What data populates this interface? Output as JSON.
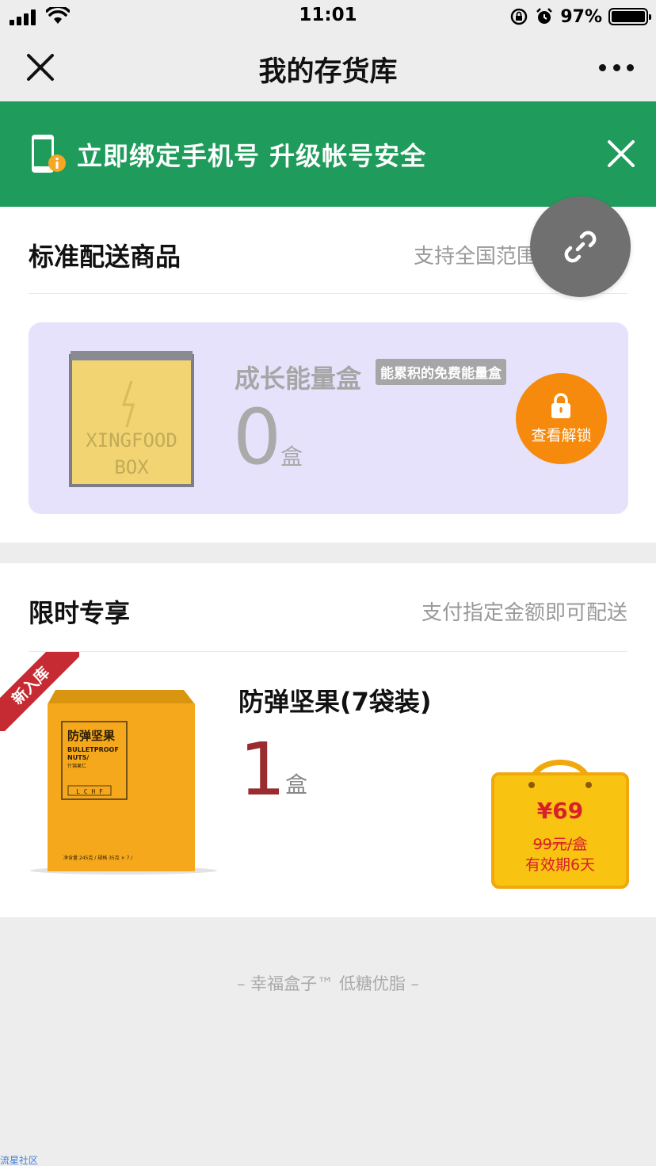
{
  "status_bar": {
    "time": "11:01",
    "battery": "97%"
  },
  "nav": {
    "title": "我的存货库"
  },
  "banner": {
    "text": "立即绑定手机号  升级帐号安全"
  },
  "standard": {
    "title": "标准配送商品",
    "subtitle": "支持全国范围",
    "card": {
      "box_text_line1": "XINGFOOD",
      "box_text_line2": "BOX",
      "name": "成长能量盒",
      "tag": "能累积的免费能量盒",
      "count": "0",
      "unit": "盒",
      "unlock_label": "查看解锁"
    }
  },
  "limited": {
    "title": "限时专享",
    "subtitle": "支付指定金额即可配送",
    "ribbon": "新入库",
    "product": {
      "box_title": "防弹坚果",
      "box_sub1": "BULLETPROOF",
      "box_sub2": "NUTS/",
      "box_sub3": "什锦果仁",
      "box_tags": "L C H F",
      "box_bottom": "净含量 245克 /  规格 35克 × 7 /",
      "name": "防弹坚果(7袋装)",
      "qty": "1",
      "unit": "盒",
      "price": "¥69",
      "original_price": "99元/盒",
      "validity": "有效期6天"
    }
  },
  "footer": "– 幸福盒子™ 低糖优脂 –",
  "watermark": "流星社区",
  "colors": {
    "banner_green": "#1f9b5c",
    "unlock_orange": "#f58a0c",
    "card_lavender": "#e6e2fb",
    "ribbon_red": "#c62a32",
    "qty_red": "#9a2b2f",
    "bag_yellow": "#f9c312"
  }
}
